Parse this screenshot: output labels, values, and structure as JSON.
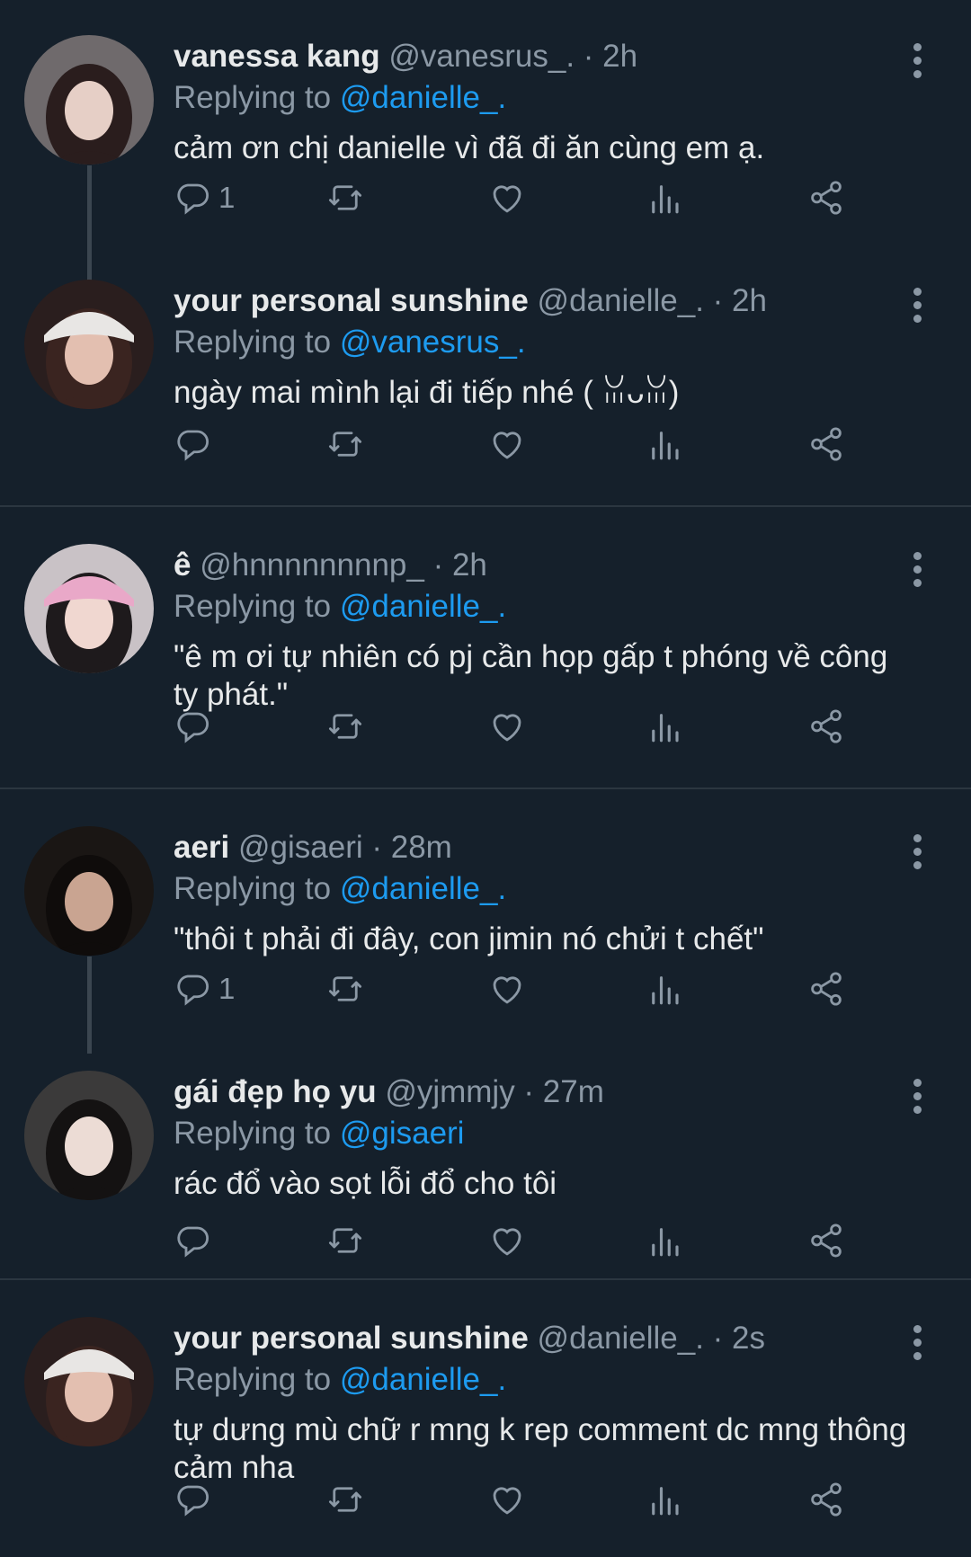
{
  "tweets": [
    {
      "name": "vanessa kang",
      "meta": "@vanesrus_. · 2h",
      "replying_prefix": "Replying to ",
      "replying_to": "@danielle_.",
      "text": "cảm ơn chị danielle vì đã đi ăn cùng em ạ.",
      "reply_count": "1"
    },
    {
      "name": "your personal sunshine",
      "meta": "@danielle_. · 2h",
      "replying_prefix": "Replying to ",
      "replying_to": "@vanesrus_.",
      "text": "ngày mai mình lại đi tiếp nhé ( ꈍᴗꈍ)",
      "reply_count": ""
    },
    {
      "name": "ê",
      "meta": "@hnnnnnnnnp_ · 2h",
      "replying_prefix": "Replying to ",
      "replying_to": "@danielle_.",
      "text": "\"ê m ơi tự nhiên có pj cần họp gấp t phóng về công ty phát.\"",
      "reply_count": ""
    },
    {
      "name": "aeri",
      "meta": "@gisaeri · 28m",
      "replying_prefix": "Replying to ",
      "replying_to": "@danielle_.",
      "text": "\"thôi t phải đi đây, con jimin nó chửi t chết\"",
      "reply_count": "1"
    },
    {
      "name": "gái đẹp họ yu",
      "meta": "@yjmmjy · 27m",
      "replying_prefix": "Replying to ",
      "replying_to": "@gisaeri",
      "text": "rác đổ vào sọt lỗi đổ cho tôi",
      "reply_count": ""
    },
    {
      "name": "your personal sunshine",
      "meta": "@danielle_. · 2s",
      "replying_prefix": "Replying to ",
      "replying_to": "@danielle_.",
      "text": "tự dưng mù chữ r mng k rep comment dc mng thông cảm nha",
      "reply_count": ""
    }
  ],
  "icons": {
    "reply": "reply-icon",
    "retweet": "retweet-icon",
    "like": "heart-icon",
    "views": "views-icon",
    "share": "share-icon",
    "more": "more-icon"
  },
  "colors": {
    "background": "#15202b",
    "mention": "#1d9bf0",
    "muted": "#8b98a5",
    "text": "#e7e9ea",
    "divider": "#2b3640"
  }
}
